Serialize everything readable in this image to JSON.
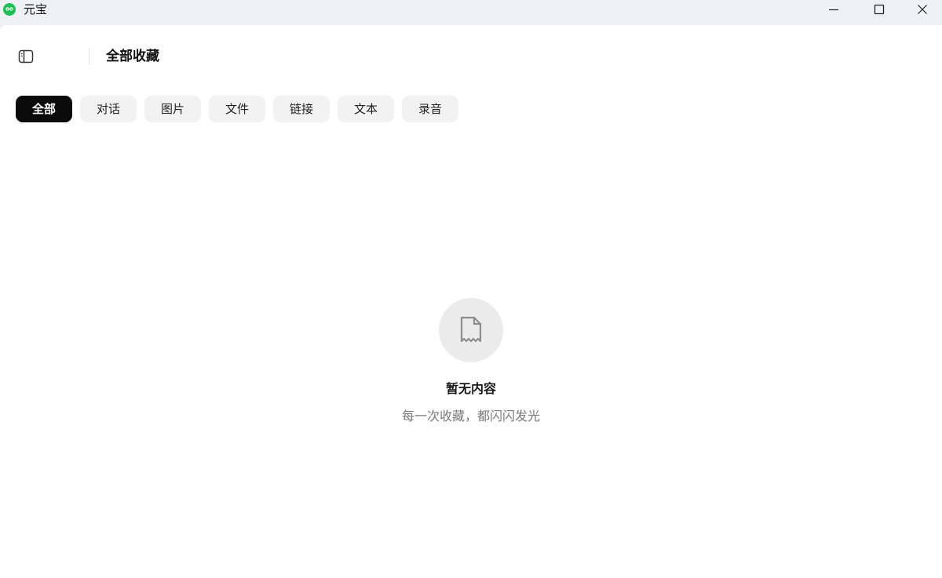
{
  "window": {
    "title": "元宝",
    "logo_icon": "yuanbao-logo-icon",
    "controls": [
      "minimize-icon",
      "maximize-icon",
      "close-icon"
    ]
  },
  "header": {
    "sidebar_toggle_icon": "sidebar-toggle-icon",
    "title": "全部收藏"
  },
  "tabs": [
    {
      "label": "全部",
      "active": true
    },
    {
      "label": "对话",
      "active": false
    },
    {
      "label": "图片",
      "active": false
    },
    {
      "label": "文件",
      "active": false
    },
    {
      "label": "链接",
      "active": false
    },
    {
      "label": "文本",
      "active": false
    },
    {
      "label": "录音",
      "active": false
    }
  ],
  "empty_state": {
    "icon": "document-icon",
    "title": "暂无内容",
    "subtitle": "每一次收藏，都闪闪发光"
  },
  "colors": {
    "titlebar_bg": "#eef1f6",
    "content_bg": "#ffffff",
    "tab_active_bg": "#0b0b0b",
    "tab_bg": "#f2f2f2",
    "logo_green": "#1fbf55"
  }
}
